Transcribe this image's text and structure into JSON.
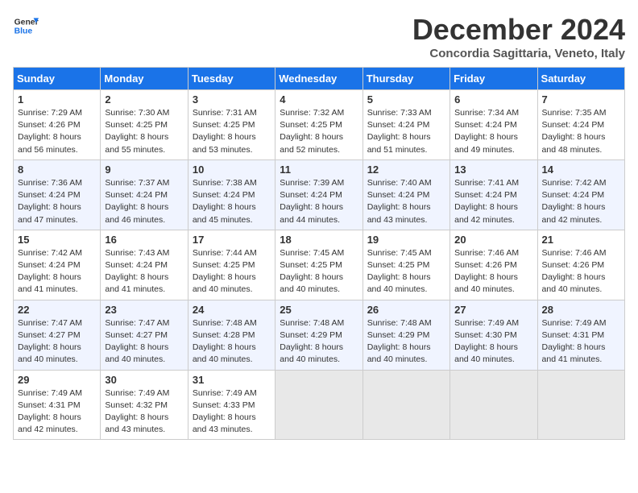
{
  "logo": {
    "line1": "General",
    "line2": "Blue"
  },
  "title": "December 2024",
  "subtitle": "Concordia Sagittaria, Veneto, Italy",
  "weekdays": [
    "Sunday",
    "Monday",
    "Tuesday",
    "Wednesday",
    "Thursday",
    "Friday",
    "Saturday"
  ],
  "weeks": [
    [
      {
        "day": 1,
        "rise": "7:29 AM",
        "set": "4:26 PM",
        "daylight": "8 hours and 56 minutes."
      },
      {
        "day": 2,
        "rise": "7:30 AM",
        "set": "4:25 PM",
        "daylight": "8 hours and 55 minutes."
      },
      {
        "day": 3,
        "rise": "7:31 AM",
        "set": "4:25 PM",
        "daylight": "8 hours and 53 minutes."
      },
      {
        "day": 4,
        "rise": "7:32 AM",
        "set": "4:25 PM",
        "daylight": "8 hours and 52 minutes."
      },
      {
        "day": 5,
        "rise": "7:33 AM",
        "set": "4:24 PM",
        "daylight": "8 hours and 51 minutes."
      },
      {
        "day": 6,
        "rise": "7:34 AM",
        "set": "4:24 PM",
        "daylight": "8 hours and 49 minutes."
      },
      {
        "day": 7,
        "rise": "7:35 AM",
        "set": "4:24 PM",
        "daylight": "8 hours and 48 minutes."
      }
    ],
    [
      {
        "day": 8,
        "rise": "7:36 AM",
        "set": "4:24 PM",
        "daylight": "8 hours and 47 minutes."
      },
      {
        "day": 9,
        "rise": "7:37 AM",
        "set": "4:24 PM",
        "daylight": "8 hours and 46 minutes."
      },
      {
        "day": 10,
        "rise": "7:38 AM",
        "set": "4:24 PM",
        "daylight": "8 hours and 45 minutes."
      },
      {
        "day": 11,
        "rise": "7:39 AM",
        "set": "4:24 PM",
        "daylight": "8 hours and 44 minutes."
      },
      {
        "day": 12,
        "rise": "7:40 AM",
        "set": "4:24 PM",
        "daylight": "8 hours and 43 minutes."
      },
      {
        "day": 13,
        "rise": "7:41 AM",
        "set": "4:24 PM",
        "daylight": "8 hours and 42 minutes."
      },
      {
        "day": 14,
        "rise": "7:42 AM",
        "set": "4:24 PM",
        "daylight": "8 hours and 42 minutes."
      }
    ],
    [
      {
        "day": 15,
        "rise": "7:42 AM",
        "set": "4:24 PM",
        "daylight": "8 hours and 41 minutes."
      },
      {
        "day": 16,
        "rise": "7:43 AM",
        "set": "4:24 PM",
        "daylight": "8 hours and 41 minutes."
      },
      {
        "day": 17,
        "rise": "7:44 AM",
        "set": "4:25 PM",
        "daylight": "8 hours and 40 minutes."
      },
      {
        "day": 18,
        "rise": "7:45 AM",
        "set": "4:25 PM",
        "daylight": "8 hours and 40 minutes."
      },
      {
        "day": 19,
        "rise": "7:45 AM",
        "set": "4:25 PM",
        "daylight": "8 hours and 40 minutes."
      },
      {
        "day": 20,
        "rise": "7:46 AM",
        "set": "4:26 PM",
        "daylight": "8 hours and 40 minutes."
      },
      {
        "day": 21,
        "rise": "7:46 AM",
        "set": "4:26 PM",
        "daylight": "8 hours and 40 minutes."
      }
    ],
    [
      {
        "day": 22,
        "rise": "7:47 AM",
        "set": "4:27 PM",
        "daylight": "8 hours and 40 minutes."
      },
      {
        "day": 23,
        "rise": "7:47 AM",
        "set": "4:27 PM",
        "daylight": "8 hours and 40 minutes."
      },
      {
        "day": 24,
        "rise": "7:48 AM",
        "set": "4:28 PM",
        "daylight": "8 hours and 40 minutes."
      },
      {
        "day": 25,
        "rise": "7:48 AM",
        "set": "4:29 PM",
        "daylight": "8 hours and 40 minutes."
      },
      {
        "day": 26,
        "rise": "7:48 AM",
        "set": "4:29 PM",
        "daylight": "8 hours and 40 minutes."
      },
      {
        "day": 27,
        "rise": "7:49 AM",
        "set": "4:30 PM",
        "daylight": "8 hours and 40 minutes."
      },
      {
        "day": 28,
        "rise": "7:49 AM",
        "set": "4:31 PM",
        "daylight": "8 hours and 41 minutes."
      }
    ],
    [
      {
        "day": 29,
        "rise": "7:49 AM",
        "set": "4:31 PM",
        "daylight": "8 hours and 42 minutes."
      },
      {
        "day": 30,
        "rise": "7:49 AM",
        "set": "4:32 PM",
        "daylight": "8 hours and 43 minutes."
      },
      {
        "day": 31,
        "rise": "7:49 AM",
        "set": "4:33 PM",
        "daylight": "8 hours and 43 minutes."
      },
      null,
      null,
      null,
      null
    ]
  ]
}
